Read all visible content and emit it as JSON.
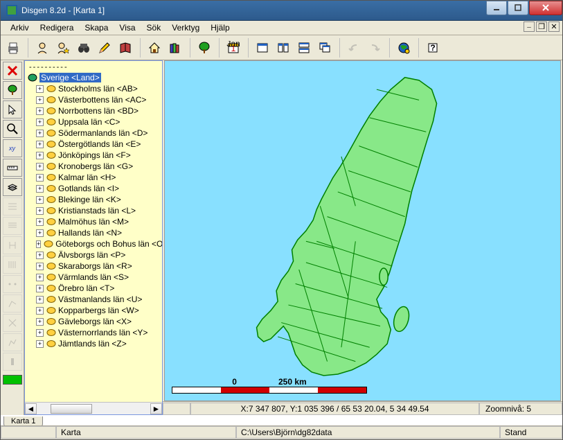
{
  "window": {
    "title": "Disgen 8.2d - [Karta 1]"
  },
  "menu": {
    "items": [
      "Arkiv",
      "Redigera",
      "Skapa",
      "Visa",
      "Sök",
      "Verktyg",
      "Hjälp"
    ]
  },
  "tree": {
    "root_label": "Sverige <Land>",
    "header": "----------",
    "items": [
      "Stockholms län <AB>",
      "Västerbottens län <AC>",
      "Norrbottens län <BD>",
      "Uppsala län <C>",
      "Södermanlands län <D>",
      "Östergötlands län <E>",
      "Jönköpings län <F>",
      "Kronobergs län <G>",
      "Kalmar län <H>",
      "Gotlands län <I>",
      "Blekinge län <K>",
      "Kristianstads län <L>",
      "Malmöhus län <M>",
      "Hallands län <N>",
      "Göteborgs och Bohus län <O>",
      "Älvsborgs län <P>",
      "Skaraborgs län <R>",
      "Värmlands län <S>",
      "Örebro län <T>",
      "Västmanlands län <U>",
      "Kopparbergs län <W>",
      "Gävleborgs län <X>",
      "Västernorrlands län <Y>",
      "Jämtlands län <Z>"
    ]
  },
  "scale": {
    "zero": "0",
    "dist": "250 km"
  },
  "mapstatus": {
    "coords": "X:7 347 807, Y:1 035 396 / 65 53 20.04, 5 34 49.54",
    "zoom": "Zoomnivå: 5"
  },
  "tabs": {
    "tab1": "Karta 1"
  },
  "status": {
    "mode": "Karta",
    "path": "C:\\Users\\Björn\\dg82data",
    "right": "Stand"
  }
}
